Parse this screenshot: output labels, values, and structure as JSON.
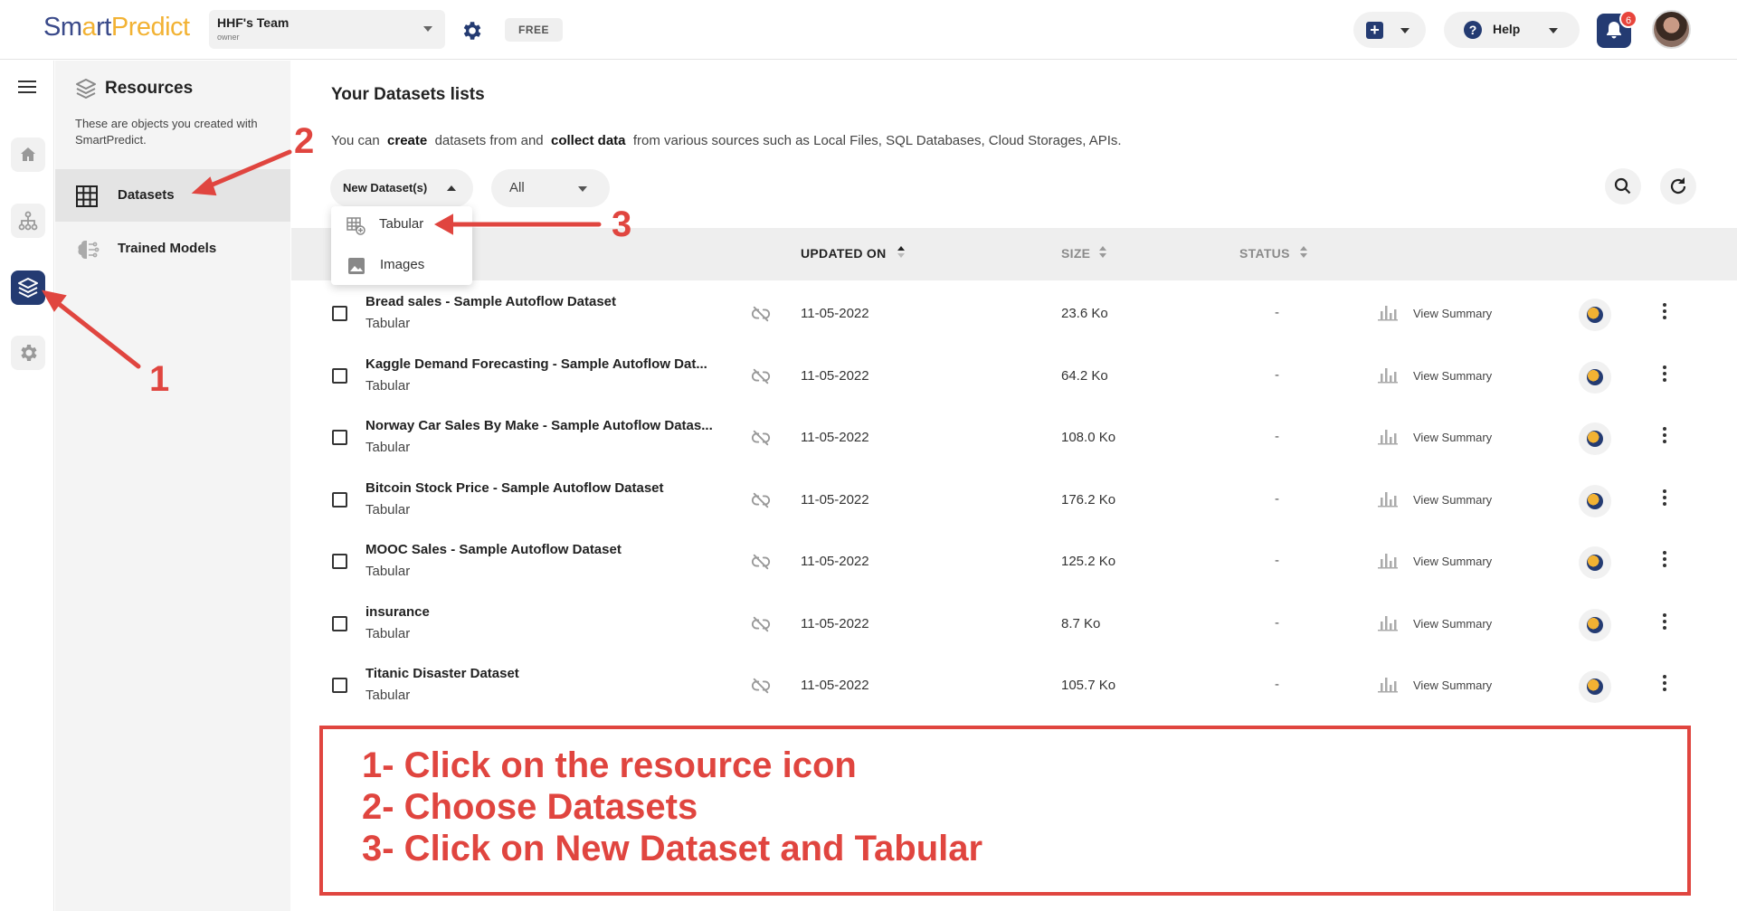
{
  "brand": {
    "name_part1": "Sm",
    "name_part2": "a",
    "name_part3": "rt",
    "name_part4": "Predict",
    "primary_color": "#243b72",
    "accent_color": "#f2b233",
    "annotation_color": "#e0453f"
  },
  "header": {
    "team_name": "HHF's Team",
    "team_role": "owner",
    "plan_badge": "FREE",
    "help_label": "Help",
    "notification_count": "6"
  },
  "resources": {
    "title": "Resources",
    "description": "These are objects you created with SmartPredict.",
    "items": [
      {
        "label": "Datasets",
        "icon": "grid-icon",
        "active": true
      },
      {
        "label": "Trained Models",
        "icon": "brain-icon",
        "active": false
      }
    ]
  },
  "main": {
    "title": "Your Datasets lists",
    "desc_pre": "You can",
    "desc_b1": "create",
    "desc_mid": "datasets from and",
    "desc_b2": "collect data",
    "desc_post": "from various sources such as Local Files, SQL Databases, Cloud Storages, APIs.",
    "new_dataset_label": "New Dataset(s)",
    "filter_value": "All",
    "dropdown": [
      {
        "label": "Tabular",
        "icon": "table-add-icon"
      },
      {
        "label": "Images",
        "icon": "image-icon"
      }
    ],
    "columns": {
      "updated_on": "UPDATED ON",
      "size": "SIZE",
      "status": "STATUS"
    },
    "rows": [
      {
        "name": "Bread sales - Sample Autoflow Dataset",
        "type": "Tabular",
        "updated": "11-05-2022",
        "size": "23.6 Ko",
        "status": "-",
        "action": "View Summary"
      },
      {
        "name": "Kaggle Demand Forecasting - Sample Autoflow Dat...",
        "type": "Tabular",
        "updated": "11-05-2022",
        "size": "64.2 Ko",
        "status": "-",
        "action": "View Summary"
      },
      {
        "name": "Norway Car Sales By Make - Sample Autoflow Datas...",
        "type": "Tabular",
        "updated": "11-05-2022",
        "size": "108.0 Ko",
        "status": "-",
        "action": "View Summary"
      },
      {
        "name": "Bitcoin Stock Price - Sample Autoflow Dataset",
        "type": "Tabular",
        "updated": "11-05-2022",
        "size": "176.2 Ko",
        "status": "-",
        "action": "View Summary"
      },
      {
        "name": "MOOC Sales - Sample Autoflow Dataset",
        "type": "Tabular",
        "updated": "11-05-2022",
        "size": "125.2 Ko",
        "status": "-",
        "action": "View Summary"
      },
      {
        "name": "insurance",
        "type": "Tabular",
        "updated": "11-05-2022",
        "size": "8.7 Ko",
        "status": "-",
        "action": "View Summary"
      },
      {
        "name": "Titanic Disaster Dataset",
        "type": "Tabular",
        "updated": "11-05-2022",
        "size": "105.7 Ko",
        "status": "-",
        "action": "View Summary"
      }
    ]
  },
  "annotations": {
    "markers": [
      "1",
      "2",
      "3"
    ],
    "lines": [
      "1- Click on the resource icon",
      "2- Choose Datasets",
      "3- Click on New Dataset and Tabular"
    ]
  }
}
